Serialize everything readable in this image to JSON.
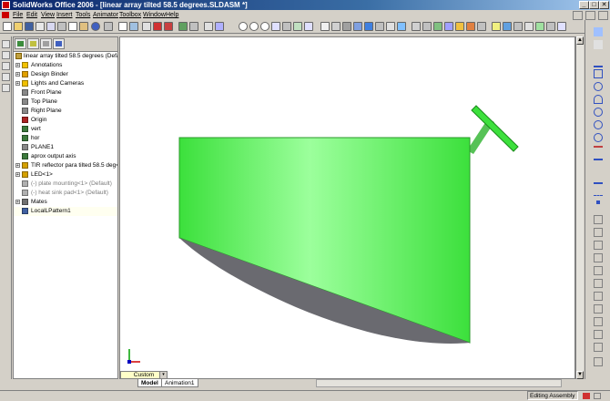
{
  "window": {
    "title": "SolidWorks Office 2006 - [linear array tilted 58.5 degrees.SLDASM *]",
    "controls": {
      "minimize": "_",
      "maximize": "□",
      "close": "✕"
    }
  },
  "menu": {
    "items": [
      "File",
      "Edit",
      "View",
      "Insert",
      "Tools",
      "Animator",
      "Toolbox",
      "Window",
      "Help"
    ]
  },
  "tree": {
    "root": "linear array tilted 58.5 degrees  (Default",
    "items": [
      {
        "label": "Annotations",
        "expand": "+",
        "icon": "annotation-icon",
        "color": "#f2c200"
      },
      {
        "label": "Design Binder",
        "expand": "+",
        "icon": "design-binder-icon",
        "color": "#e0a000"
      },
      {
        "label": "Lights and Cameras",
        "expand": "+",
        "icon": "lights-icon",
        "color": "#f0c000"
      },
      {
        "label": "Front Plane",
        "expand": "",
        "icon": "plane-icon",
        "color": "#888888"
      },
      {
        "label": "Top Plane",
        "expand": "",
        "icon": "plane-icon",
        "color": "#888888"
      },
      {
        "label": "Right Plane",
        "expand": "",
        "icon": "plane-icon",
        "color": "#888888"
      },
      {
        "label": "Origin",
        "expand": "",
        "icon": "origin-icon",
        "color": "#aa2222"
      },
      {
        "label": "vert",
        "expand": "",
        "icon": "axis-icon",
        "color": "#3c7a3c"
      },
      {
        "label": "hor",
        "expand": "",
        "icon": "axis-icon",
        "color": "#3c7a3c"
      },
      {
        "label": "PLANE1",
        "expand": "",
        "icon": "plane-icon",
        "color": "#888888"
      },
      {
        "label": "aprox output axis",
        "expand": "",
        "icon": "axis-icon",
        "color": "#3c7a3c"
      },
      {
        "label": "TIR reflector para tilted 58.5 deg<",
        "expand": "+",
        "icon": "part-icon",
        "color": "#d4a000"
      },
      {
        "label": "LED<1>",
        "expand": "+",
        "icon": "part-icon",
        "color": "#d4a000"
      },
      {
        "label": "(-) plate mounting<1> (Default)",
        "expand": "",
        "icon": "suppressed-part-icon",
        "color": "#b0b0b0",
        "suppressed": true
      },
      {
        "label": "(-) heat sink pad<1> (Default)",
        "expand": "",
        "icon": "suppressed-part-icon",
        "color": "#b0b0b0",
        "suppressed": true
      },
      {
        "label": "Mates",
        "expand": "+",
        "icon": "mates-icon",
        "color": "#707070"
      },
      {
        "label": "LocalLPattern1",
        "expand": "",
        "icon": "pattern-icon",
        "color": "#4060a0",
        "selected": true
      }
    ]
  },
  "view_selector": {
    "value": "Custom",
    "arrow": "▾"
  },
  "bottom_tabs": [
    "Model",
    "Animation1"
  ],
  "status": {
    "right": "Editing Assembly"
  },
  "colors": {
    "part_green": "#3ce03c",
    "part_green_light": "#9cff9c",
    "part_shadow": "#6a6a70",
    "stem_green": "#56c256",
    "titlebar": "#0a246a"
  }
}
